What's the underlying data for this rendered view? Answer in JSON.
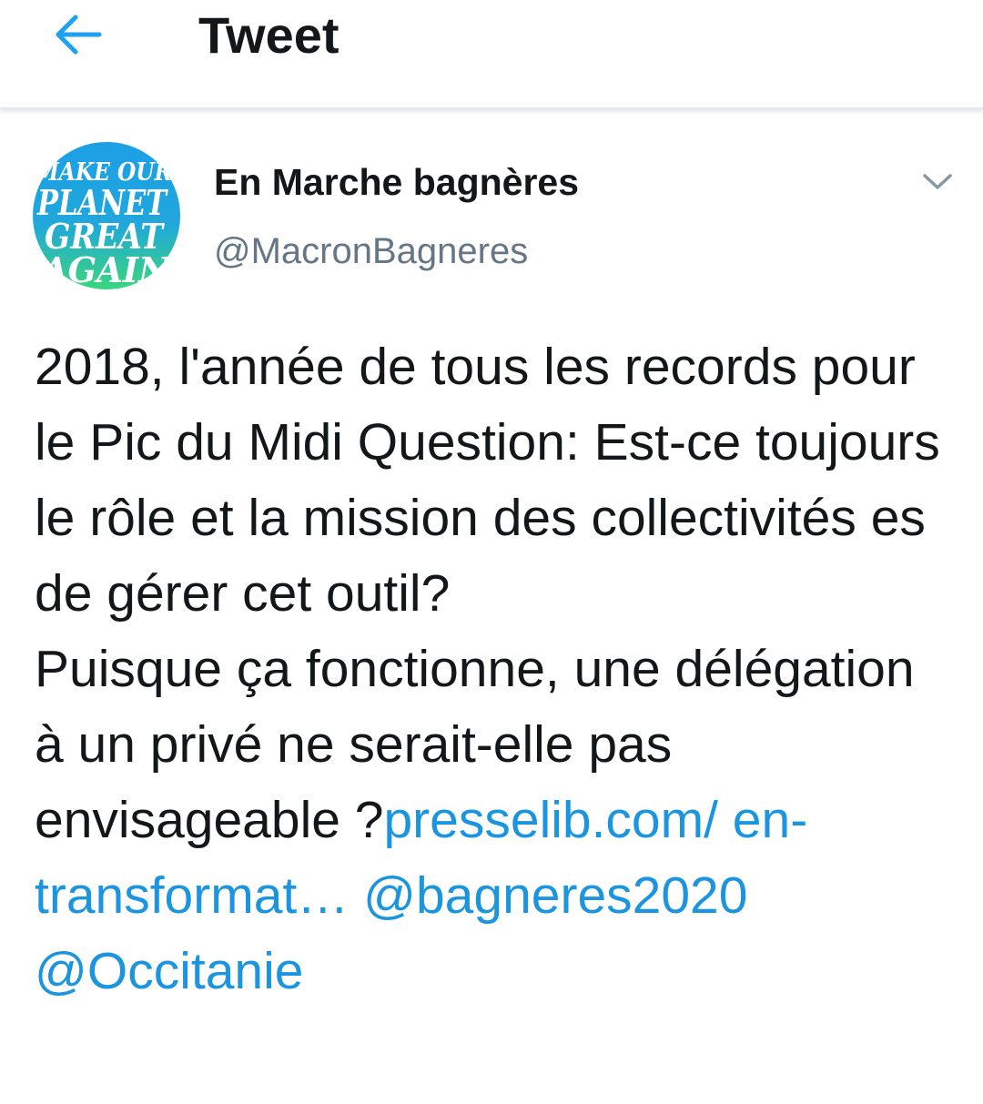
{
  "header": {
    "title": "Tweet",
    "back_icon": "arrow-left-icon",
    "accent_color": "#1da1f2"
  },
  "tweet": {
    "avatar": {
      "lines": [
        "MAKE OUR",
        "PLANET",
        "GREAT",
        "AGAIN"
      ]
    },
    "display_name": "En Marche bagnères",
    "handle": "@MacronBagneres",
    "menu_icon": "chevron-down-icon",
    "body": {
      "paragraph1": "2018, l'année de tous les records pour le Pic du Midi  Question: Est-ce toujours le rôle et la mission des collectivités es de gérer cet outil?",
      "paragraph2": "Puisque ça fonctionne, une délégation à un privé ne serait-elle pas envisageable ?",
      "link_url": "presselib.com/ en-transformat…",
      "mention1": "@bagneres2020",
      "mention2": "@Occitanie"
    },
    "link_color": "#1b95e0",
    "text_color": "#14171a",
    "muted_color": "#657786"
  }
}
